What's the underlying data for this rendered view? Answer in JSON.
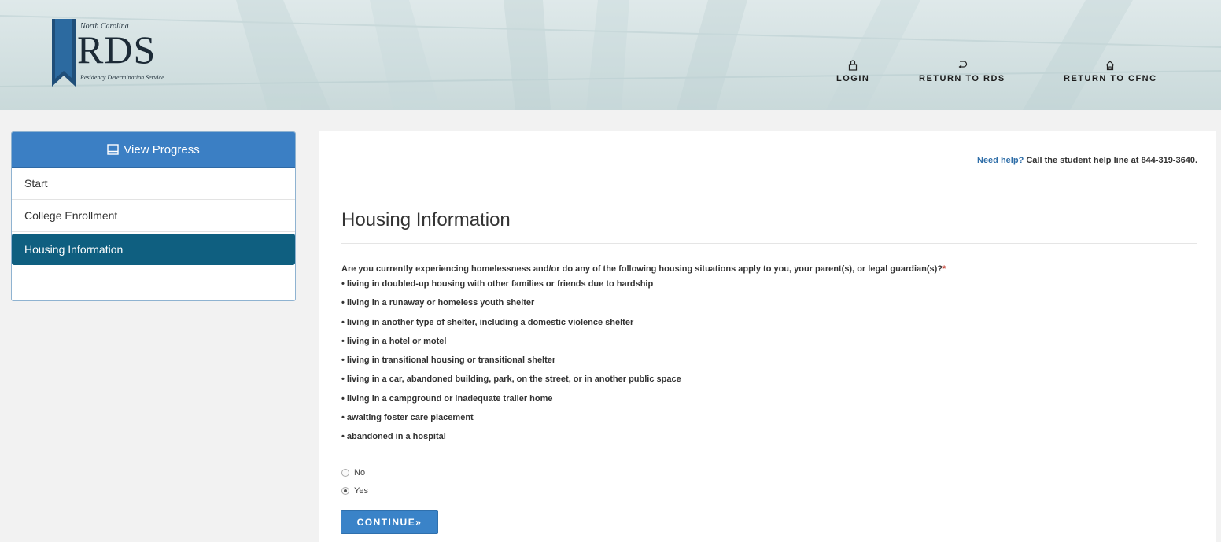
{
  "header": {
    "logo": {
      "state": "North Carolina",
      "title": "RDS",
      "subtitle": "Residency Determination Service"
    },
    "nav": [
      {
        "label": "LOGIN",
        "icon": "lock-icon"
      },
      {
        "label": "RETURN TO RDS",
        "icon": "return-arrow-icon"
      },
      {
        "label": "RETURN TO CFNC",
        "icon": "home-icon"
      }
    ]
  },
  "sidebar": {
    "header": "View Progress",
    "items": [
      {
        "label": "Start",
        "active": false
      },
      {
        "label": "College Enrollment",
        "active": false
      },
      {
        "label": "Housing Information",
        "active": true
      }
    ]
  },
  "main": {
    "help": {
      "prefix": "Need help?",
      "text": " Call the student help line at ",
      "phone": "844-319-3640."
    },
    "title": "Housing Information",
    "question": "Are you currently experiencing homelessness and/or do any of the following housing situations apply to you, your parent(s), or legal guardian(s)?",
    "required_mark": "*",
    "situations": [
      "living in doubled-up housing with other families or friends due to hardship",
      "living in a runaway or homeless youth shelter",
      "living in another type of shelter, including a domestic violence shelter",
      "living in a hotel or motel",
      "living in transitional housing or transitional shelter",
      "living in a car, abandoned building, park, on the street, or in another public space",
      "living in a campground or inadequate trailer home",
      "awaiting foster care placement",
      "abandoned in a hospital"
    ],
    "options": [
      {
        "label": "No",
        "selected": false
      },
      {
        "label": "Yes",
        "selected": true
      }
    ],
    "continue_label": "CONTINUE",
    "continue_glyph": "»"
  },
  "colors": {
    "primary": "#3b7fc4",
    "active_nav": "#0f5f80",
    "link": "#2f6ea8",
    "required": "#c0392b"
  }
}
